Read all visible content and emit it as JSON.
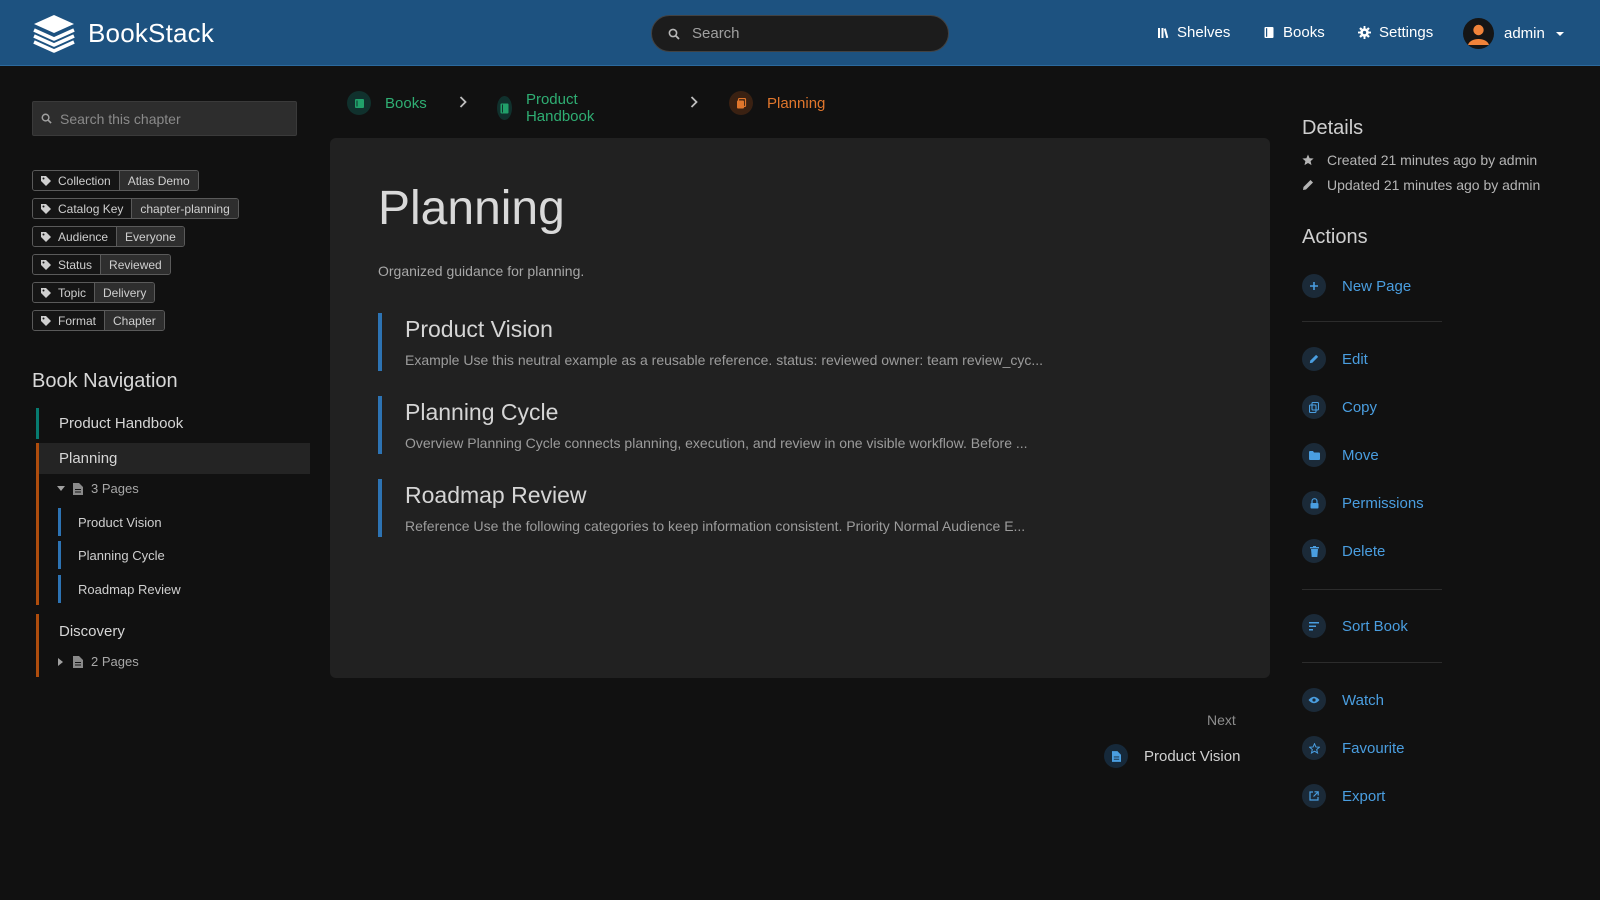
{
  "header": {
    "app_name": "BookStack",
    "search_placeholder": "Search",
    "nav": {
      "shelves": "Shelves",
      "books": "Books",
      "settings": "Settings"
    },
    "user_name": "admin"
  },
  "sidebar": {
    "chapter_search_placeholder": "Search this chapter",
    "tags": [
      {
        "name": "Collection",
        "value": "Atlas Demo"
      },
      {
        "name": "Catalog Key",
        "value": "chapter-planning"
      },
      {
        "name": "Audience",
        "value": "Everyone"
      },
      {
        "name": "Status",
        "value": "Reviewed"
      },
      {
        "name": "Topic",
        "value": "Delivery"
      },
      {
        "name": "Format",
        "value": "Chapter"
      }
    ],
    "book_nav_title": "Book Navigation",
    "book_name": "Product Handbook",
    "chapters": [
      {
        "name": "Planning",
        "pages_count": "3 Pages",
        "pages": [
          "Product Vision",
          "Planning Cycle",
          "Roadmap Review"
        ]
      },
      {
        "name": "Discovery",
        "pages_count": "2 Pages"
      }
    ]
  },
  "breadcrumb": {
    "books": "Books",
    "book": "Product Handbook",
    "chapter": "Planning"
  },
  "main": {
    "title": "Planning",
    "description": "Organized guidance for planning.",
    "pages": [
      {
        "title": "Product Vision",
        "excerpt": "Example Use this neutral example as a reusable reference. status: reviewed owner: team review_cyc..."
      },
      {
        "title": "Planning Cycle",
        "excerpt": "Overview Planning Cycle connects planning, execution, and review in one visible workflow. Before ..."
      },
      {
        "title": "Roadmap Review",
        "excerpt": "Reference Use the following categories to keep information consistent. Priority Normal Audience E..."
      }
    ]
  },
  "next": {
    "label": "Next",
    "page": "Product Vision"
  },
  "details": {
    "title": "Details",
    "created": "Created 21 minutes ago by admin",
    "updated": "Updated 21 minutes ago by admin"
  },
  "actions": {
    "title": "Actions",
    "new_page": "New Page",
    "edit": "Edit",
    "copy": "Copy",
    "move": "Move",
    "permissions": "Permissions",
    "delete": "Delete",
    "sort_book": "Sort Book",
    "watch": "Watch",
    "favourite": "Favourite",
    "export": "Export"
  },
  "colors": {
    "header": "#1d5280",
    "book": "#077b70",
    "chapter": "#af4d0d",
    "page": "#2d73b3",
    "link": "#4a9ee0"
  }
}
